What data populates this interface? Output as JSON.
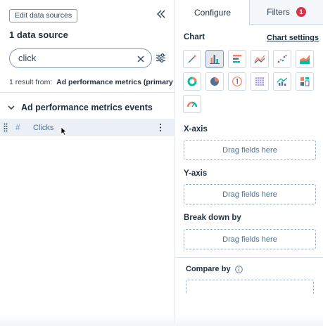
{
  "left": {
    "edit_button": "Edit data sources",
    "data_source_count": "1 data source",
    "search": {
      "value": "click"
    },
    "result_prefix": "1 result from:",
    "result_source": "Ad performance metrics (primary",
    "group": {
      "label": "Ad performance metrics events"
    },
    "field": {
      "type_symbol": "#",
      "label": "Clicks"
    }
  },
  "right": {
    "tabs": {
      "configure": "Configure",
      "filters": "Filters",
      "filters_badge": "1"
    },
    "chart": {
      "title": "Chart",
      "settings_link": "Chart settings",
      "selected_type": "vertical-bar",
      "types": [
        "magic-wand",
        "vertical-bar",
        "horizontal-bar",
        "line",
        "scatter",
        "area",
        "donut",
        "pie",
        "kpi",
        "pivot-table",
        "combination",
        "summary",
        "gauge"
      ]
    },
    "x_axis": {
      "label": "X-axis",
      "placeholder": "Drag fields here"
    },
    "y_axis": {
      "label": "Y-axis",
      "placeholder": "Drag fields here"
    },
    "break_down": {
      "label": "Break down by",
      "placeholder": "Drag fields here"
    },
    "compare_by": {
      "label": "Compare by"
    }
  },
  "colors": {
    "accent": "#ff7a59",
    "teal": "#00bda5",
    "blue": "#516f90",
    "badge": "#d4364b"
  }
}
